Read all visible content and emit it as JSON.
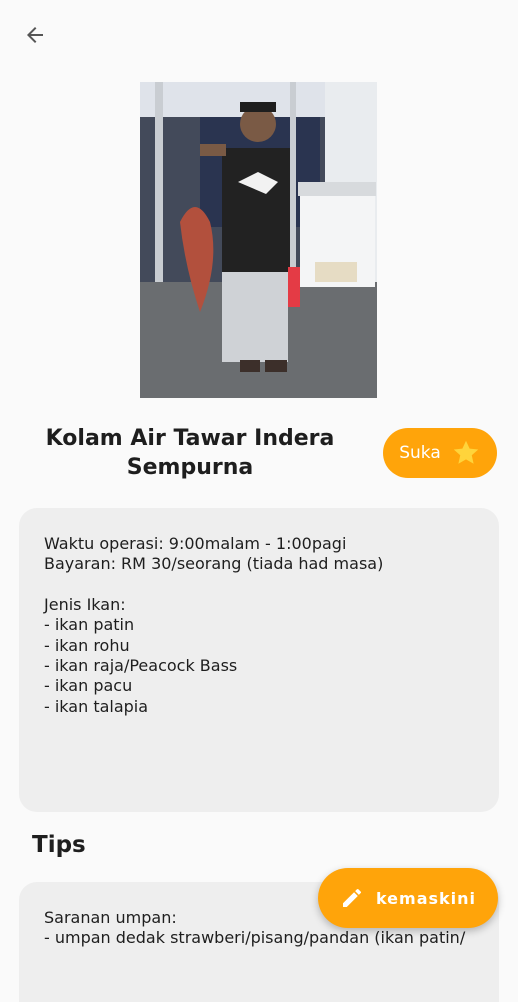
{
  "header": {
    "back_icon": "arrow-left-icon"
  },
  "spot": {
    "name_line1": "Kolam Air Tawar Indera",
    "name_line2": "Sempurna",
    "like_label": "Suka"
  },
  "info": {
    "operating_hours": "Waktu operasi: 9:00malam - 1:00pagi",
    "payment": "Bayaran: RM 30/seorang (tiada had masa)",
    "fish_heading": "Jenis Ikan:",
    "fish": [
      "- ikan patin",
      "- ikan rohu",
      "- ikan raja/Peacock Bass",
      "- ikan pacu",
      "- ikan talapia"
    ]
  },
  "tips": {
    "heading": "Tips",
    "bait_heading": "Saranan umpan:",
    "bait_line": "- umpan dedak strawberi/pisang/pandan (ikan patin/"
  },
  "fab": {
    "label": "kemaskini",
    "icon": "pencil-icon"
  },
  "colors": {
    "accent": "#ffa40a",
    "star": "#ffd43b",
    "card": "#eeeeee"
  }
}
